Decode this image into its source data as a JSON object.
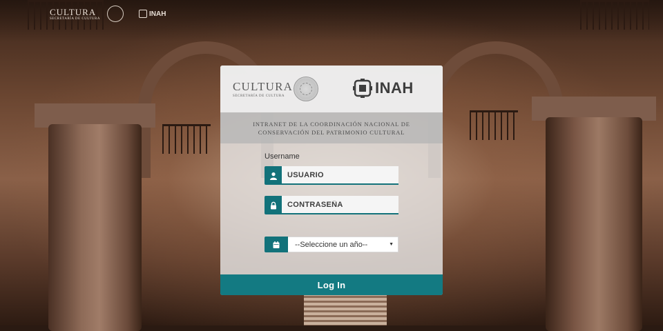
{
  "header": {
    "cultura": "CULTURA",
    "cultura_sub": "SECRETARÍA DE CULTURA",
    "inah": "INAH"
  },
  "panel": {
    "cultura_logo": "CULTURA",
    "cultura_sub": "SECRETARÍA DE CULTURA",
    "inah_logo": "INAH",
    "title": "INTRANET DE LA COORDINACIÓN NACIONAL DE CONSERVACIÓN DEL PATRIMONIO CULTURAL",
    "username_label": "Username",
    "username_placeholder": "USUARIO",
    "password_placeholder": "CONTRASEÑA",
    "year_select": "--Seleccione un año--",
    "login_label": "Log In"
  },
  "icons": {
    "username": "user-icon",
    "password": "lock-icon",
    "year": "calendar-icon",
    "select": "caret-down-icon"
  },
  "colors": {
    "accent": "#137a82"
  }
}
